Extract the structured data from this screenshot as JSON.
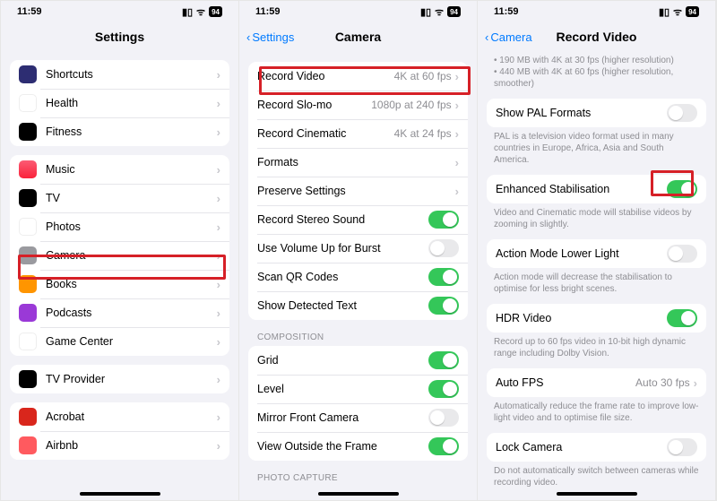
{
  "status": {
    "time": "11:59",
    "battery": "94"
  },
  "panel1": {
    "title": "Settings",
    "groups": [
      [
        {
          "name": "shortcuts",
          "label": "Shortcuts"
        },
        {
          "name": "health",
          "label": "Health"
        },
        {
          "name": "fitness",
          "label": "Fitness"
        }
      ],
      [
        {
          "name": "music",
          "label": "Music"
        },
        {
          "name": "tv",
          "label": "TV"
        },
        {
          "name": "photos",
          "label": "Photos"
        },
        {
          "name": "camera",
          "label": "Camera"
        },
        {
          "name": "books",
          "label": "Books"
        },
        {
          "name": "podcasts",
          "label": "Podcasts"
        },
        {
          "name": "gamecenter",
          "label": "Game Center"
        }
      ],
      [
        {
          "name": "tvprovider",
          "label": "TV Provider"
        }
      ],
      [
        {
          "name": "acrobat",
          "label": "Acrobat"
        },
        {
          "name": "airbnb",
          "label": "Airbnb"
        }
      ]
    ]
  },
  "panel2": {
    "back": "Settings",
    "title": "Camera",
    "rows": [
      {
        "name": "record-video",
        "label": "Record Video",
        "detail": "4K at 60 fps",
        "type": "nav"
      },
      {
        "name": "record-slomo",
        "label": "Record Slo-mo",
        "detail": "1080p at 240 fps",
        "type": "nav"
      },
      {
        "name": "record-cinematic",
        "label": "Record Cinematic",
        "detail": "4K at 24 fps",
        "type": "nav"
      },
      {
        "name": "formats",
        "label": "Formats",
        "type": "nav"
      },
      {
        "name": "preserve-settings",
        "label": "Preserve Settings",
        "type": "nav"
      },
      {
        "name": "record-stereo-sound",
        "label": "Record Stereo Sound",
        "type": "toggle",
        "on": true
      },
      {
        "name": "volume-up-burst",
        "label": "Use Volume Up for Burst",
        "type": "toggle",
        "on": false
      },
      {
        "name": "scan-qr",
        "label": "Scan QR Codes",
        "type": "toggle",
        "on": true
      },
      {
        "name": "show-detected-text",
        "label": "Show Detected Text",
        "type": "toggle",
        "on": true
      }
    ],
    "composition_header": "COMPOSITION",
    "composition": [
      {
        "name": "grid",
        "label": "Grid",
        "type": "toggle",
        "on": true
      },
      {
        "name": "level",
        "label": "Level",
        "type": "toggle",
        "on": true
      },
      {
        "name": "mirror-front",
        "label": "Mirror Front Camera",
        "type": "toggle",
        "on": false
      },
      {
        "name": "view-outside-frame",
        "label": "View Outside the Frame",
        "type": "toggle",
        "on": true
      }
    ],
    "photo_capture_header": "PHOTO CAPTURE"
  },
  "panel3": {
    "back": "Camera",
    "title": "Record Video",
    "top_note_1": "• 190 MB with 4K at 30 fps (higher resolution)",
    "top_note_2": "• 440 MB with 4K at 60 fps (higher resolution, smoother)",
    "rows": [
      {
        "name": "show-pal",
        "label": "Show PAL Formats",
        "type": "toggle",
        "on": false,
        "note": "PAL is a television video format used in many countries in Europe, Africa, Asia and South America."
      },
      {
        "name": "enhanced-stabilisation",
        "label": "Enhanced Stabilisation",
        "type": "toggle",
        "on": true,
        "note": "Video and Cinematic mode will stabilise videos by zooming in slightly."
      },
      {
        "name": "action-mode-lower",
        "label": "Action Mode Lower Light",
        "type": "toggle",
        "on": false,
        "note": "Action mode will decrease the stabilisation to optimise for less bright scenes."
      },
      {
        "name": "hdr-video",
        "label": "HDR Video",
        "type": "toggle",
        "on": true,
        "note": "Record up to 60 fps video in 10-bit high dynamic range including Dolby Vision."
      },
      {
        "name": "auto-fps",
        "label": "Auto FPS",
        "type": "nav",
        "detail": "Auto 30 fps",
        "note": "Automatically reduce the frame rate to improve low-light video and to optimise file size."
      },
      {
        "name": "lock-camera",
        "label": "Lock Camera",
        "type": "toggle",
        "on": false,
        "note": "Do not automatically switch between cameras while recording video."
      }
    ]
  }
}
